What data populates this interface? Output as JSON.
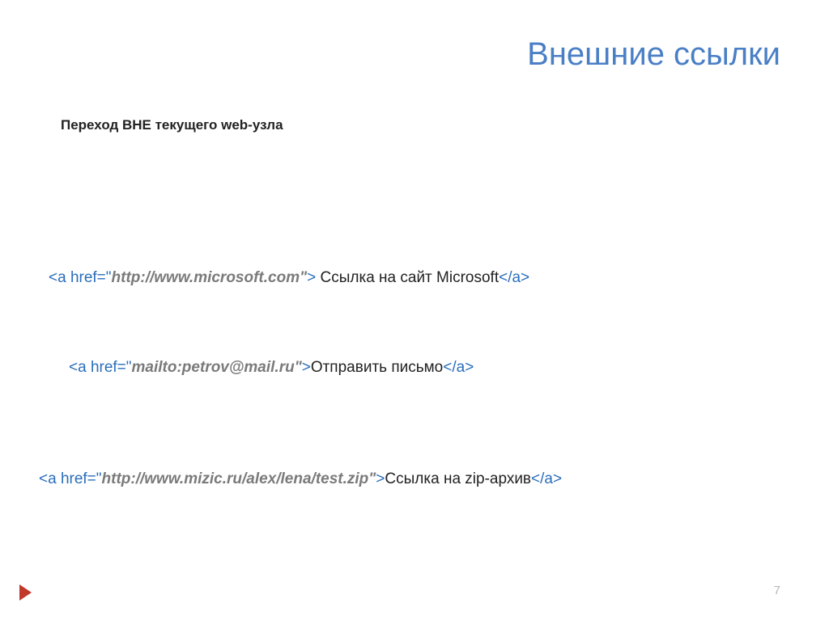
{
  "title": "Внешние ссылки",
  "subtitle": "Переход ВНЕ текущего web-узла",
  "lines": {
    "one": {
      "open": "<a href=\"",
      "url": "http://www.microsoft.com",
      "midquote": "\"",
      "close_open": "> ",
      "text": "Ссылка на сайт Microsoft",
      "close": "</a>"
    },
    "two": {
      "open": "<a href=\"",
      "url": "mailto:petrov@mail.ru",
      "midquote": "\"",
      "close_open": ">",
      "text": "Отправить письмо",
      "close": "</a>"
    },
    "three": {
      "open": "<a href=\"",
      "url": "http://www.mizic.ru/alex/lena/test.zip",
      "midquote": "\"",
      "close_open": ">",
      "text": "Ссылка на zip-архив",
      "close": "</a>"
    }
  },
  "pageNumber": "7"
}
